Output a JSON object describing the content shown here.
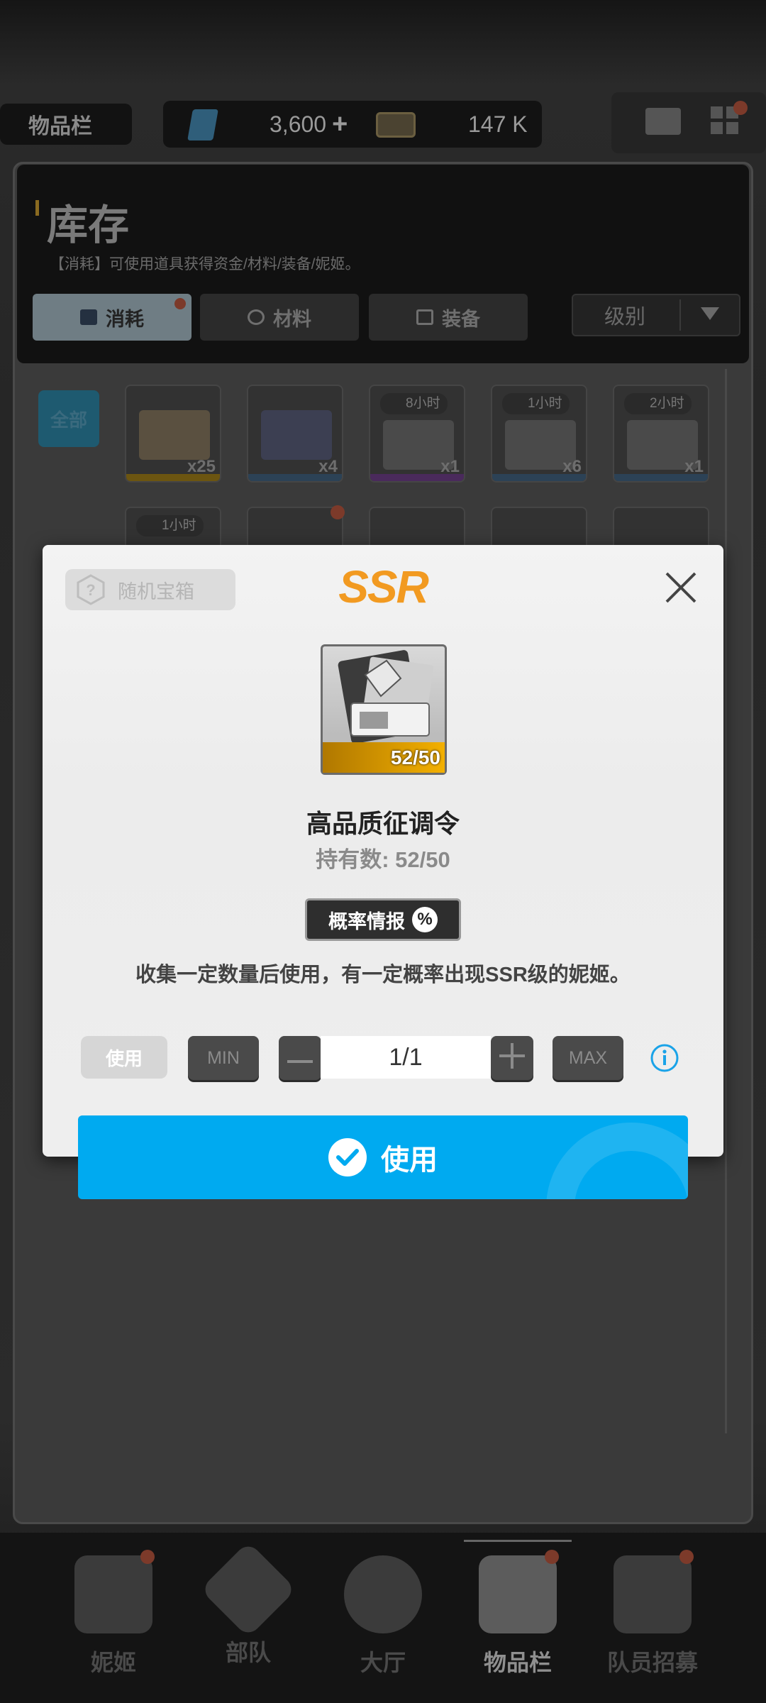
{
  "topbar": {
    "inventory_label": "物品栏",
    "gems": "3,600",
    "gems_plus": "+",
    "credits": "147 K"
  },
  "header": {
    "title": "库存",
    "subtitle": "【消耗】可使用道具获得资金/材料/装备/妮姬。",
    "tabs": [
      {
        "label": "消耗"
      },
      {
        "label": "材料"
      },
      {
        "label": "装备"
      }
    ],
    "sort_label": "级别"
  },
  "filter": {
    "all_label": "全部"
  },
  "grid": {
    "row1": [
      {
        "qty": "x25",
        "tag": ""
      },
      {
        "qty": "x4",
        "tag": ""
      },
      {
        "qty": "x1",
        "tag": "8小时"
      },
      {
        "qty": "x6",
        "tag": "1小时"
      },
      {
        "qty": "x1",
        "tag": "2小时"
      }
    ],
    "row2_tag": "1小时"
  },
  "bottom_nav": [
    {
      "label": "妮姬"
    },
    {
      "label": "部队"
    },
    {
      "label": "大厅"
    },
    {
      "label": "物品栏"
    },
    {
      "label": "队员招募"
    }
  ],
  "dialog": {
    "category": "随机宝箱",
    "rarity": "SSR",
    "item_count_badge": "52/50",
    "item_name": "高品质征调令",
    "held": "持有数: 52/50",
    "prob_label": "概率情报",
    "description": "收集一定数量后使用，有一定概率出现SSR级的妮姬。",
    "use_chip": "使用",
    "min_label": "MIN",
    "max_label": "MAX",
    "quantity": "1/1",
    "use_button": "使用"
  },
  "colors": {
    "accent": "#00aaf0",
    "ssr": "#f29a21",
    "item_bar": "#e7a600"
  }
}
